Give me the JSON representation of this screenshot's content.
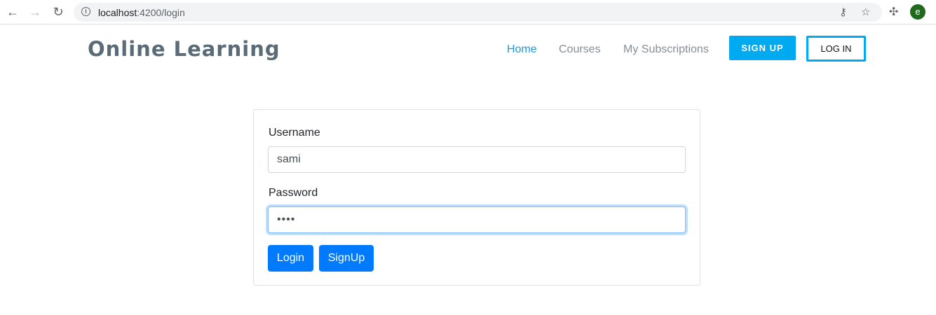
{
  "browser": {
    "url_host": "localhost",
    "url_path": ":4200/login",
    "profile_initial": "e"
  },
  "header": {
    "brand": "Online Learning",
    "nav": [
      {
        "label": "Home",
        "active": true
      },
      {
        "label": "Courses",
        "active": false
      },
      {
        "label": "My Subscriptions",
        "active": false
      }
    ],
    "signup_label": "SIGN UP",
    "login_label": "LOG IN"
  },
  "form": {
    "username_label": "Username",
    "username_value": "sami",
    "password_label": "Password",
    "password_value": "••••",
    "login_button": "Login",
    "signup_button": "SignUp"
  },
  "colors": {
    "accent": "#00aaf0",
    "primary_button": "#007bff",
    "brand_text": "#5a6b78"
  }
}
